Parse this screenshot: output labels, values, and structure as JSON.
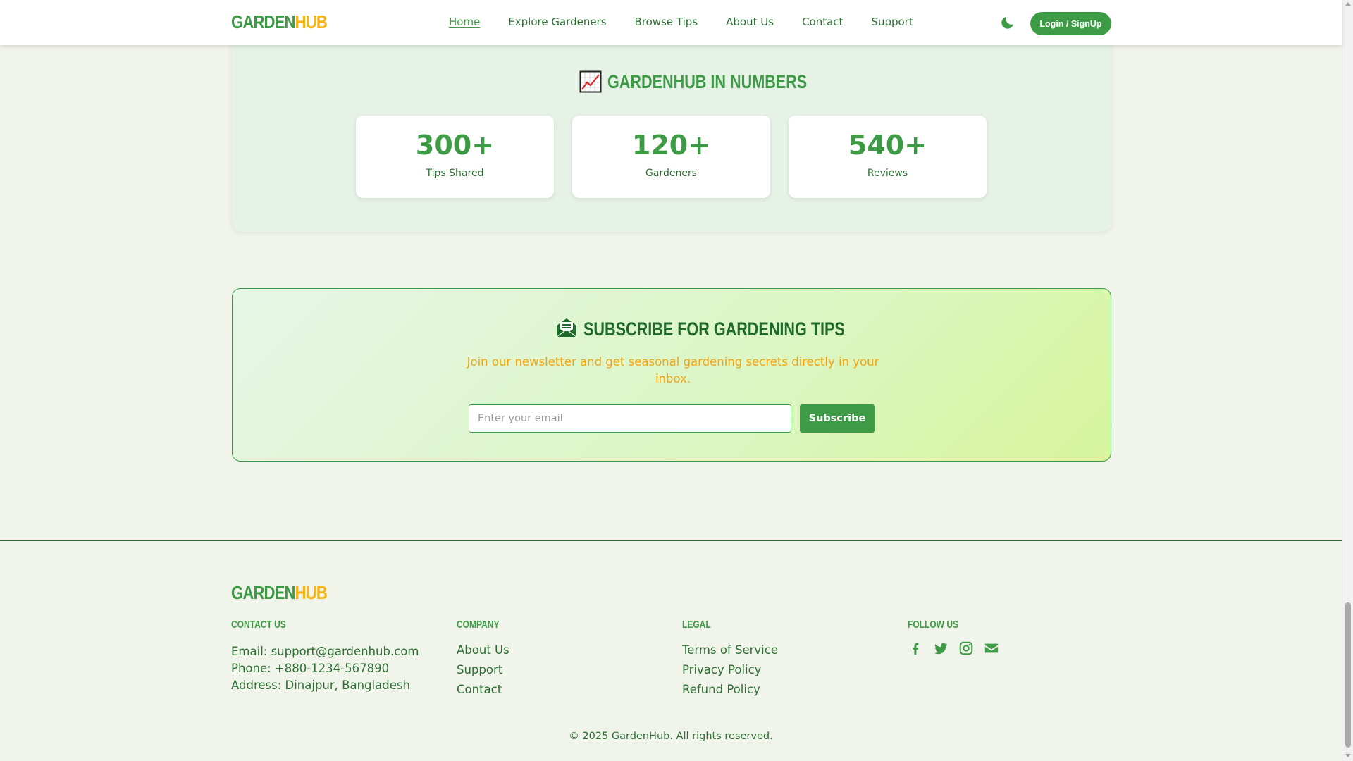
{
  "brand": {
    "part1": "GARDEN",
    "part2": "HUB",
    "primary_color": "#3e9b45",
    "accent_color": "#f6b416"
  },
  "nav": {
    "links": [
      "Home",
      "Explore Gardeners",
      "Browse Tips",
      "About Us",
      "Contact",
      "Support"
    ],
    "active": "Home",
    "theme_toggle_icon": "moon-icon",
    "login_label": "Login / SignUp"
  },
  "stats": {
    "title": "GARDENHUB IN NUMBERS",
    "icon": "chart-increasing-icon",
    "items": [
      {
        "value": "300+",
        "label": "Tips Shared"
      },
      {
        "value": "120+",
        "label": "Gardeners"
      },
      {
        "value": "540+",
        "label": "Reviews"
      }
    ]
  },
  "newsletter": {
    "icon": "envelope-open-icon",
    "title": "SUBSCRIBE FOR GARDENING TIPS",
    "text": "Join our newsletter and get seasonal gardening secrets directly in your inbox.",
    "placeholder": "Enter your email",
    "button": "Subscribe"
  },
  "footer": {
    "contact": {
      "heading": "CONTACT US",
      "email": "Email: support@gardenhub.com",
      "phone": "Phone: +880-1234-567890",
      "address": "Address: Dinajpur, Bangladesh"
    },
    "company": {
      "heading": "COMPANY",
      "links": [
        "About Us",
        "Support",
        "Contact"
      ]
    },
    "legal": {
      "heading": "LEGAL",
      "links": [
        "Terms of Service",
        "Privacy Policy",
        "Refund Policy"
      ]
    },
    "follow": {
      "heading": "FOLLOW US",
      "icons": [
        "facebook-icon",
        "twitter-icon",
        "instagram-icon",
        "email-icon"
      ]
    },
    "copyright": "© 2025 GardenHub. All rights reserved."
  }
}
